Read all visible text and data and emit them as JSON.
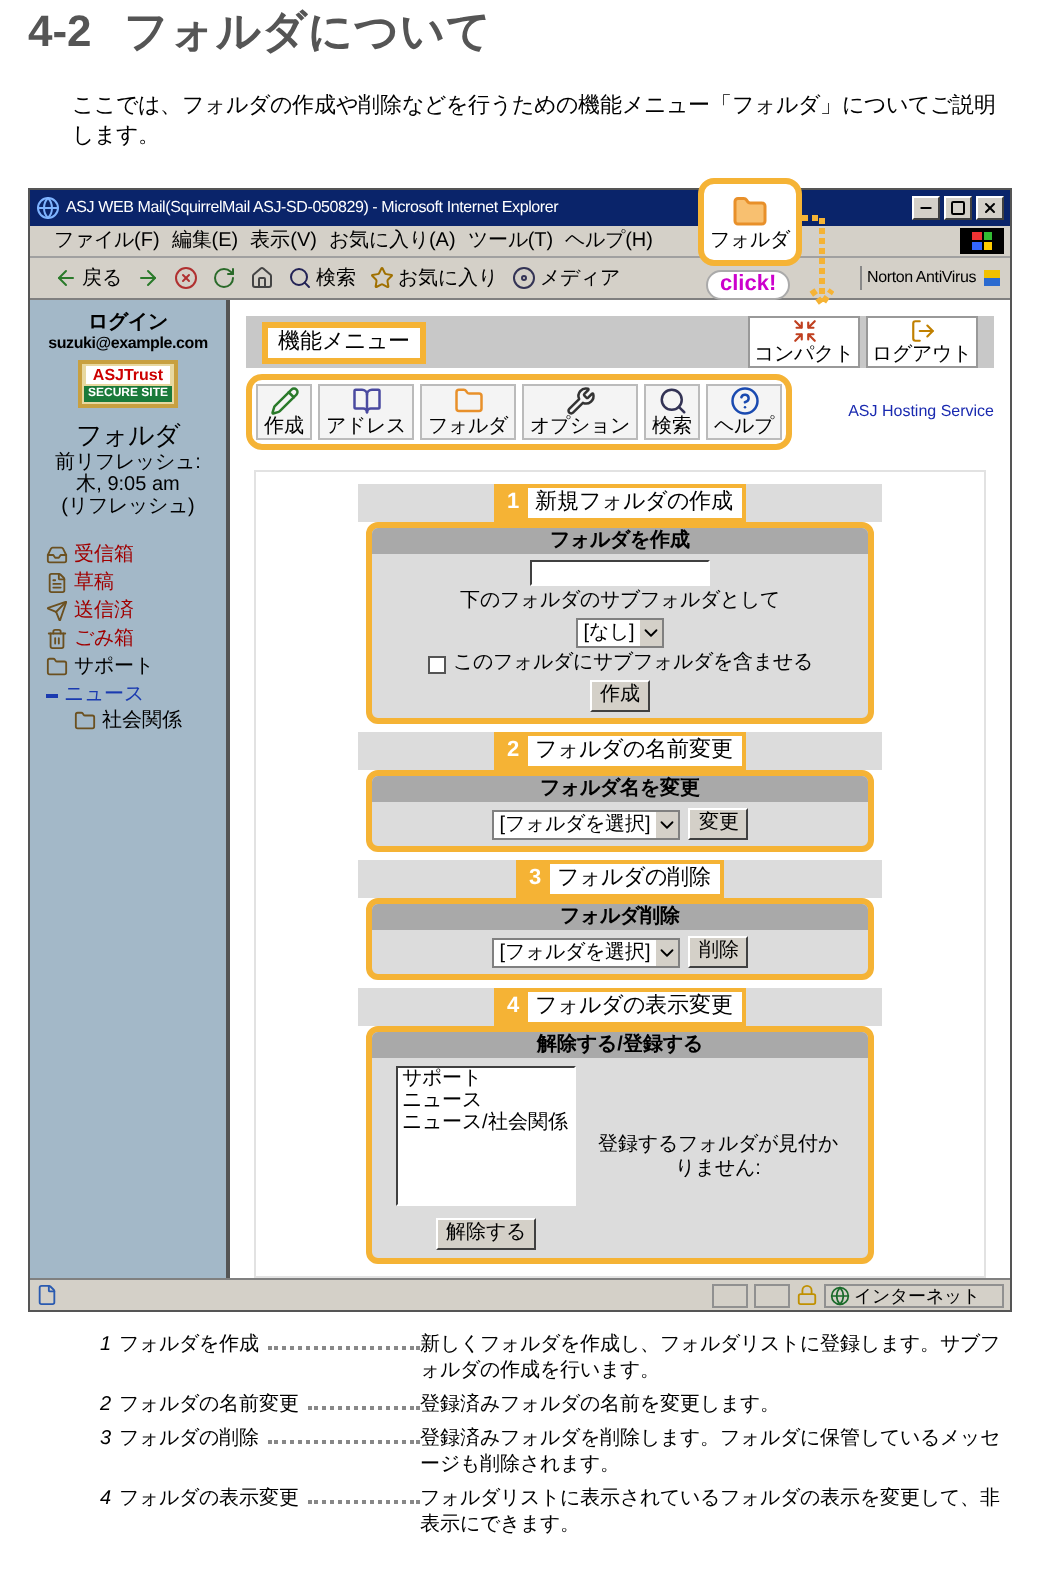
{
  "heading": {
    "number": "4-2",
    "title": "フォルダについて"
  },
  "intro": "ここでは、フォルダの作成や削除などを行うための機能メニュー「フォルダ」についてご説明します。",
  "browser": {
    "title": "ASJ WEB Mail(SquirrelMail ASJ-SD-050829) - Microsoft Internet Explorer",
    "menu": [
      "ファイル(F)",
      "編集(E)",
      "表示(V)",
      "お気に入り(A)",
      "ツール(T)",
      "ヘルプ(H)"
    ],
    "toolbar": [
      {
        "kind": "back",
        "label": "戻る"
      },
      {
        "kind": "forward"
      },
      {
        "kind": "stop"
      },
      {
        "kind": "refresh"
      },
      {
        "kind": "home"
      },
      {
        "kind": "search",
        "label": "検索"
      },
      {
        "kind": "favorites",
        "label": "お気に入り"
      },
      {
        "kind": "media",
        "label": "メディア"
      }
    ],
    "norton": "Norton AntiVirus",
    "status": "インターネット"
  },
  "callout": {
    "label": "フォルダ",
    "note": "click!"
  },
  "sidebar": {
    "login_label": "ログイン",
    "user": "suzuki@example.com",
    "badge": {
      "top": "ASJTrust",
      "bottom": "SECURE SITE"
    },
    "title": "フォルダ",
    "refresh_label": "前リフレッシュ:",
    "refresh_time": "木, 9:05 am",
    "refresh_link": "(リフレッシュ)",
    "folders": [
      {
        "kind": "inbox",
        "name": "受信箱"
      },
      {
        "kind": "draft",
        "name": "草稿"
      },
      {
        "kind": "sent",
        "name": "送信済"
      },
      {
        "kind": "trash",
        "name": "ごみ箱"
      },
      {
        "kind": "folder",
        "name": "サポート"
      },
      {
        "kind": "group",
        "name": "ニュース",
        "expanded": true,
        "children": [
          {
            "kind": "folder",
            "name": "社会関係"
          }
        ]
      }
    ]
  },
  "function_menu": {
    "label": "機能メニュー",
    "items": [
      {
        "kind": "compose",
        "label": "作成"
      },
      {
        "kind": "address",
        "label": "アドレス"
      },
      {
        "kind": "folders",
        "label": "フォルダ"
      },
      {
        "kind": "options",
        "label": "オプション"
      },
      {
        "kind": "search",
        "label": "検索"
      },
      {
        "kind": "help",
        "label": "ヘルプ"
      }
    ],
    "right_items": [
      {
        "kind": "compact",
        "label": "コンパクト"
      },
      {
        "kind": "logout",
        "label": "ログアウト"
      }
    ],
    "service": "ASJ Hosting Service"
  },
  "sections": [
    {
      "number": "1",
      "label": "新規フォルダの作成",
      "kind": "create",
      "header": "フォルダを作成",
      "subfolder_label": "下のフォルダのサブフォルダとして",
      "select": "[なし]",
      "checkbox": {
        "label": "このフォルダにサブフォルダを含ませる",
        "checked": false
      },
      "button": "作成"
    },
    {
      "number": "2",
      "label": "フォルダの名前変更",
      "kind": "select",
      "header": "フォルダ名を変更",
      "select": "[フォルダを選択]",
      "button": "変更"
    },
    {
      "number": "3",
      "label": "フォルダの削除",
      "kind": "select",
      "header": "フォルダ削除",
      "select": "[フォルダを選択]",
      "button": "削除"
    },
    {
      "number": "4",
      "label": "フォルダの表示変更",
      "kind": "subscribe",
      "header": "解除する/登録する",
      "list": [
        "サポート",
        "ニュース",
        "ニュース/社会関係"
      ],
      "message": "登録するフォルダが見付かりません:",
      "button": "解除する"
    }
  ],
  "notes": [
    {
      "number": "1",
      "label": "フォルダを作成",
      "text": "新しくフォルダを作成し、フォルダリストに登録します。サブフォルダの作成を行います。"
    },
    {
      "number": "2",
      "label": "フォルダの名前変更",
      "text": "登録済みフォルダの名前を変更します。"
    },
    {
      "number": "3",
      "label": "フォルダの削除",
      "text": "登録済みフォルダを削除します。フォルダに保管しているメッセージも削除されます。"
    },
    {
      "number": "4",
      "label": "フォルダの表示変更",
      "text": "フォルダリストに表示されているフォルダの表示を変更して、非表示にできます。"
    }
  ]
}
